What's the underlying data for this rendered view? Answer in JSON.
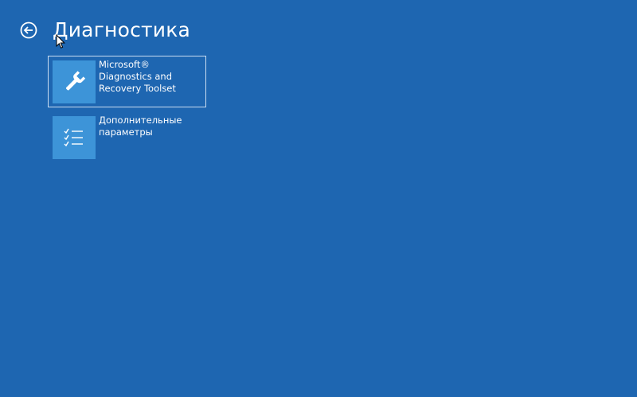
{
  "header": {
    "title": "Диагностика",
    "back_icon": "back-arrow-circle-icon"
  },
  "tiles": [
    {
      "icon": "wrench-icon",
      "lines": [
        "Microsoft®",
        "Diagnostics and",
        "Recovery Toolset"
      ],
      "selected": true
    },
    {
      "icon": "checklist-icon",
      "lines": [
        "Дополнительные",
        "параметры"
      ],
      "selected": false
    }
  ],
  "colors": {
    "background": "#1e66b1",
    "tile_icon_bg": "#3d94d8",
    "selection_border": "#c9ddf1",
    "text": "#ffffff"
  }
}
